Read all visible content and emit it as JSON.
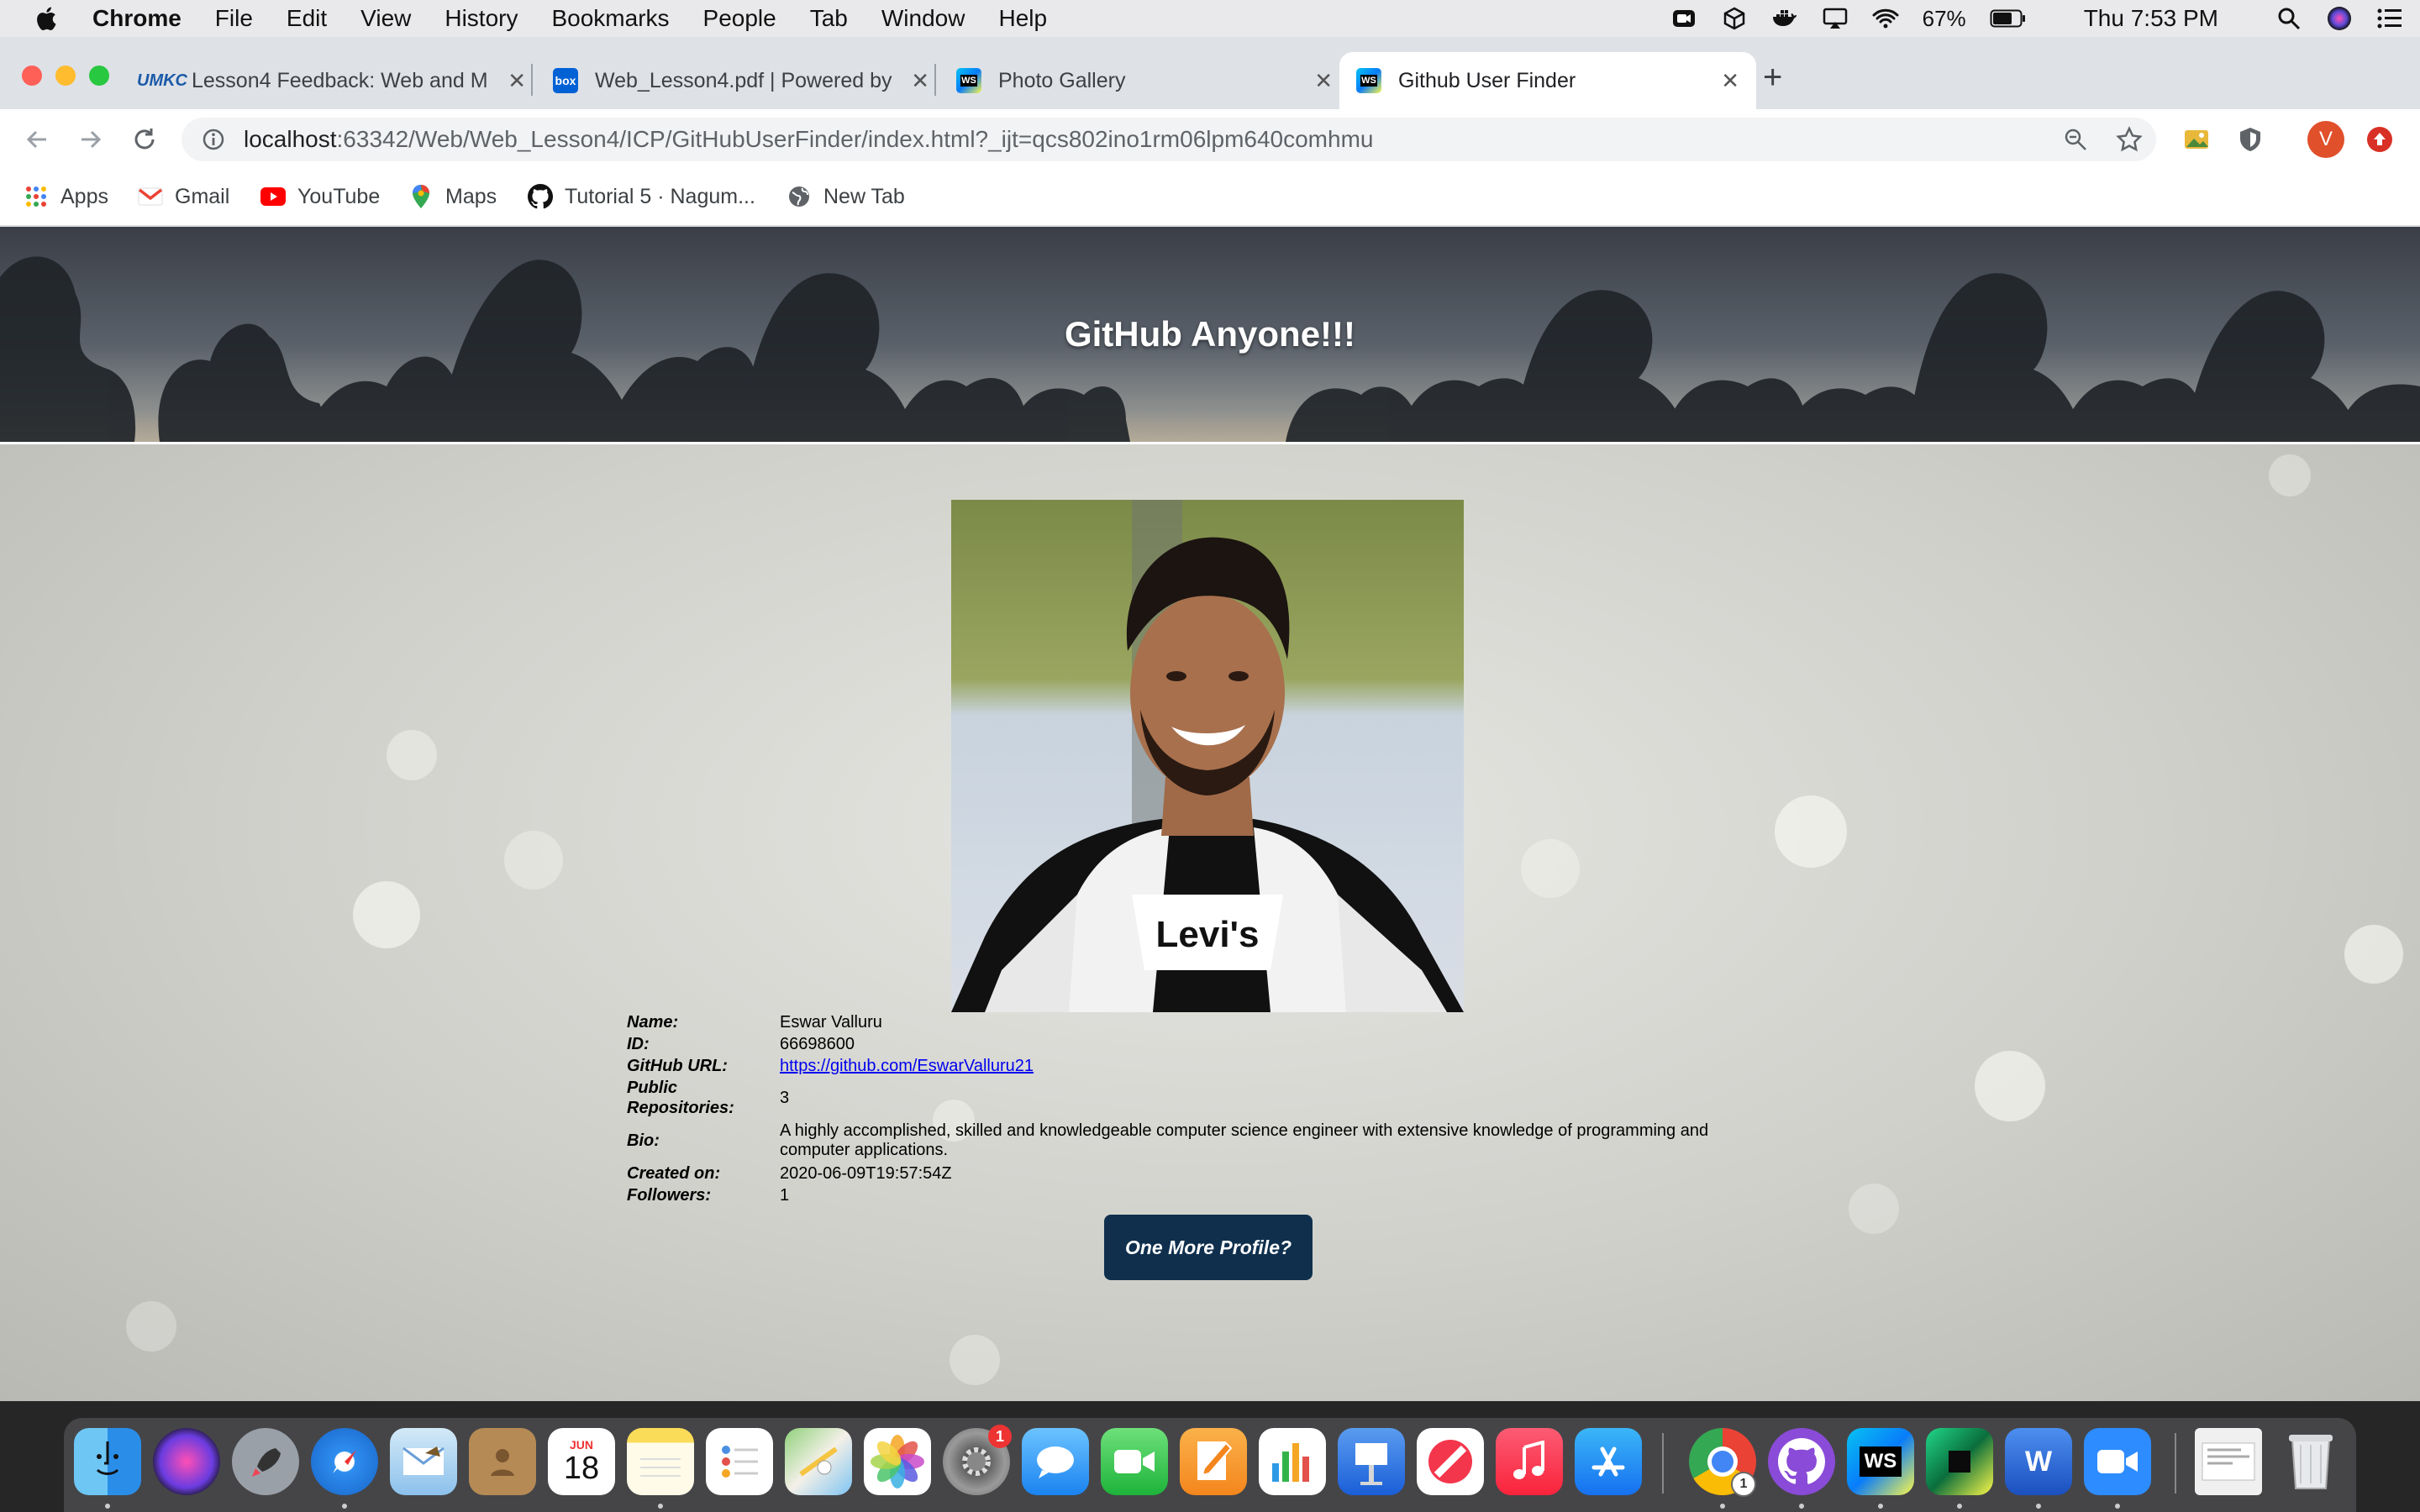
{
  "menubar": {
    "app": "Chrome",
    "menus": [
      "File",
      "Edit",
      "View",
      "History",
      "Bookmarks",
      "People",
      "Tab",
      "Window",
      "Help"
    ],
    "battery": "67%",
    "clock": "Thu 7:53 PM"
  },
  "tabs": [
    {
      "title": "Lesson4 Feedback: Web and M",
      "icon": "unkc-favicon-icon"
    },
    {
      "title": "Web_Lesson4.pdf | Powered by",
      "icon": "box-favicon-icon",
      "favicon_text": "box"
    },
    {
      "title": "Photo Gallery",
      "icon": "webstorm-favicon-icon"
    },
    {
      "title": "Github User Finder",
      "icon": "webstorm-favicon-icon",
      "active": true
    }
  ],
  "address": {
    "host": "localhost",
    "rest": ":63342/Web/Web_Lesson4/ICP/GitHubUserFinder/index.html?_ijt=qcs802ino1rm06lpm640comhmu"
  },
  "profile_initial": "V",
  "bookmarks": [
    "Apps",
    "Gmail",
    "YouTube",
    "Maps",
    "Tutorial 5 · Nagum...",
    "New Tab"
  ],
  "page": {
    "header_title": "GitHub Anyone!!!",
    "labels": {
      "name": "Name:",
      "id": "ID:",
      "url": "GitHub URL:",
      "repos": "Public Repositories:",
      "bio": "Bio:",
      "created": "Created on:",
      "followers": "Followers:"
    },
    "values": {
      "name": "Eswar Valluru",
      "id": "66698600",
      "url": "https://github.com/EswarValluru21",
      "repos": "3",
      "bio": "A highly accomplished, skilled and knowledgeable computer science engineer with extensive knowledge of programming and computer applications.",
      "created": "2020-06-09T19:57:54Z",
      "followers": "1"
    },
    "button": "One More Profile?",
    "shirt_text": "Levi's"
  },
  "dock": {
    "calendar_month": "JUN",
    "calendar_day": "18",
    "badge_settings": "1",
    "badge_chrome": "1"
  }
}
